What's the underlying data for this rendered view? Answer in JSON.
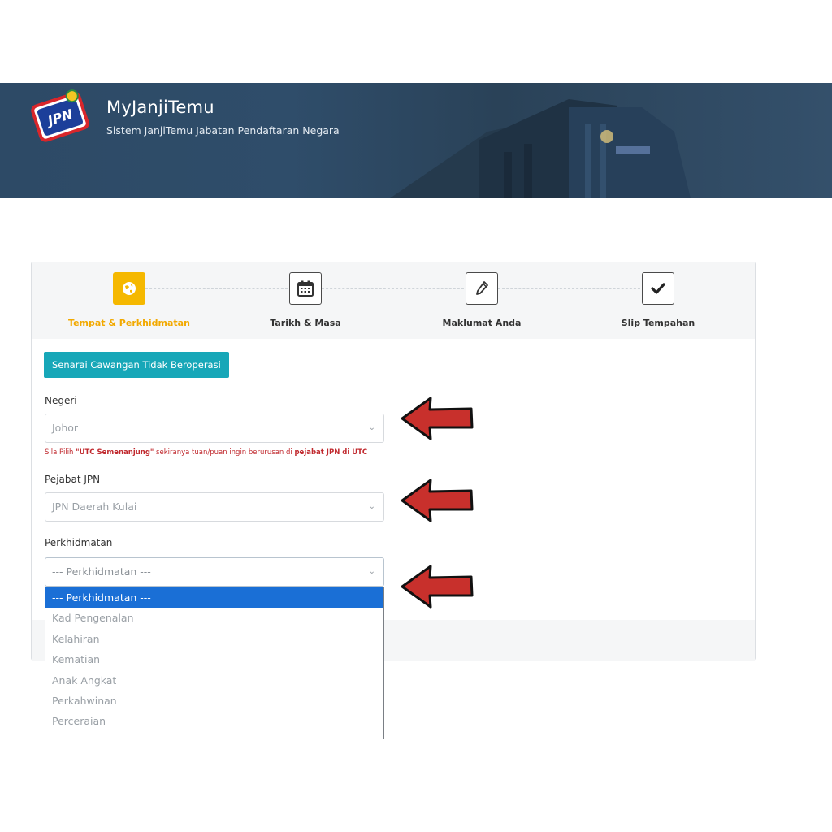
{
  "header": {
    "title": "MyJanjiTemu",
    "subtitle": "Sistem JanjiTemu Jabatan Pendaftaran Negara",
    "logo_text": "JPN"
  },
  "steps": [
    {
      "label": "Tempat & Perkhidmatan",
      "icon": "globe-icon",
      "active": true
    },
    {
      "label": "Tarikh & Masa",
      "icon": "calendar-icon",
      "active": false
    },
    {
      "label": "Maklumat Anda",
      "icon": "pencil-icon",
      "active": false
    },
    {
      "label": "Slip Tempahan",
      "icon": "check-icon",
      "active": false
    }
  ],
  "branches_button": "Senarai Cawangan Tidak Beroperasi",
  "form": {
    "negeri": {
      "label": "Negeri",
      "value": "Johor"
    },
    "hint": {
      "prefix": "Sila Pilih ",
      "highlight": "\"UTC Semenanjung\"",
      "middle": " sekiranya tuan/puan ingin berurusan di ",
      "highlight2": "pejabat JPN di UTC"
    },
    "pejabat": {
      "label": "Pejabat JPN",
      "value": "JPN Daerah Kulai"
    },
    "perkhidmatan": {
      "label": "Perkhidmatan",
      "value": "--- Perkhidmatan ---",
      "options": [
        "--- Perkhidmatan ---",
        "Kad Pengenalan",
        "Kelahiran",
        "Kematian",
        "Anak Angkat",
        "Perkahwinan",
        "Perceraian"
      ]
    }
  },
  "colors": {
    "accent": "#f5b800",
    "button": "#17a7b8",
    "selected_option": "#1a6fd6",
    "hint": "#c0282d",
    "arrow": "#c8302c"
  }
}
